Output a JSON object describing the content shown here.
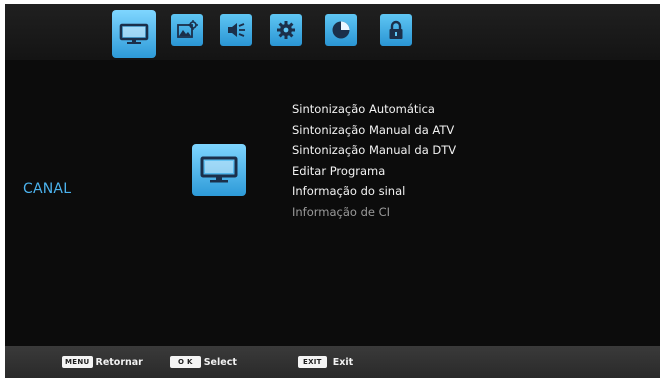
{
  "top_tabs": [
    {
      "name": "channel-tv-icon",
      "active": true
    },
    {
      "name": "picture-icon",
      "active": false
    },
    {
      "name": "sound-speaker-icon",
      "active": false
    },
    {
      "name": "settings-gear-icon",
      "active": false
    },
    {
      "name": "time-clock-icon",
      "active": false
    },
    {
      "name": "lock-icon",
      "active": false
    }
  ],
  "section": {
    "label": "CANAL",
    "icon": "channel-tv-icon"
  },
  "menu": {
    "items": [
      {
        "label": "Sintonização Automática",
        "enabled": true
      },
      {
        "label": "Sintonização Manual da ATV",
        "enabled": true
      },
      {
        "label": "Sintonização Manual da DTV",
        "enabled": true
      },
      {
        "label": "Editar Programa",
        "enabled": true
      },
      {
        "label": "Informação do sinal",
        "enabled": true
      },
      {
        "label": "Informação de CI",
        "enabled": false
      }
    ]
  },
  "footer": {
    "menu_key": "MENU",
    "menu_label": "Retornar",
    "ok_key": "O K",
    "ok_label": "Select",
    "exit_key": "EXIT",
    "exit_label": "Exit"
  },
  "colors": {
    "accent": "#2d9ad8",
    "section_label": "#4cb3ee",
    "background": "#0c0c0c",
    "disabled_text": "#9a9a9a"
  }
}
